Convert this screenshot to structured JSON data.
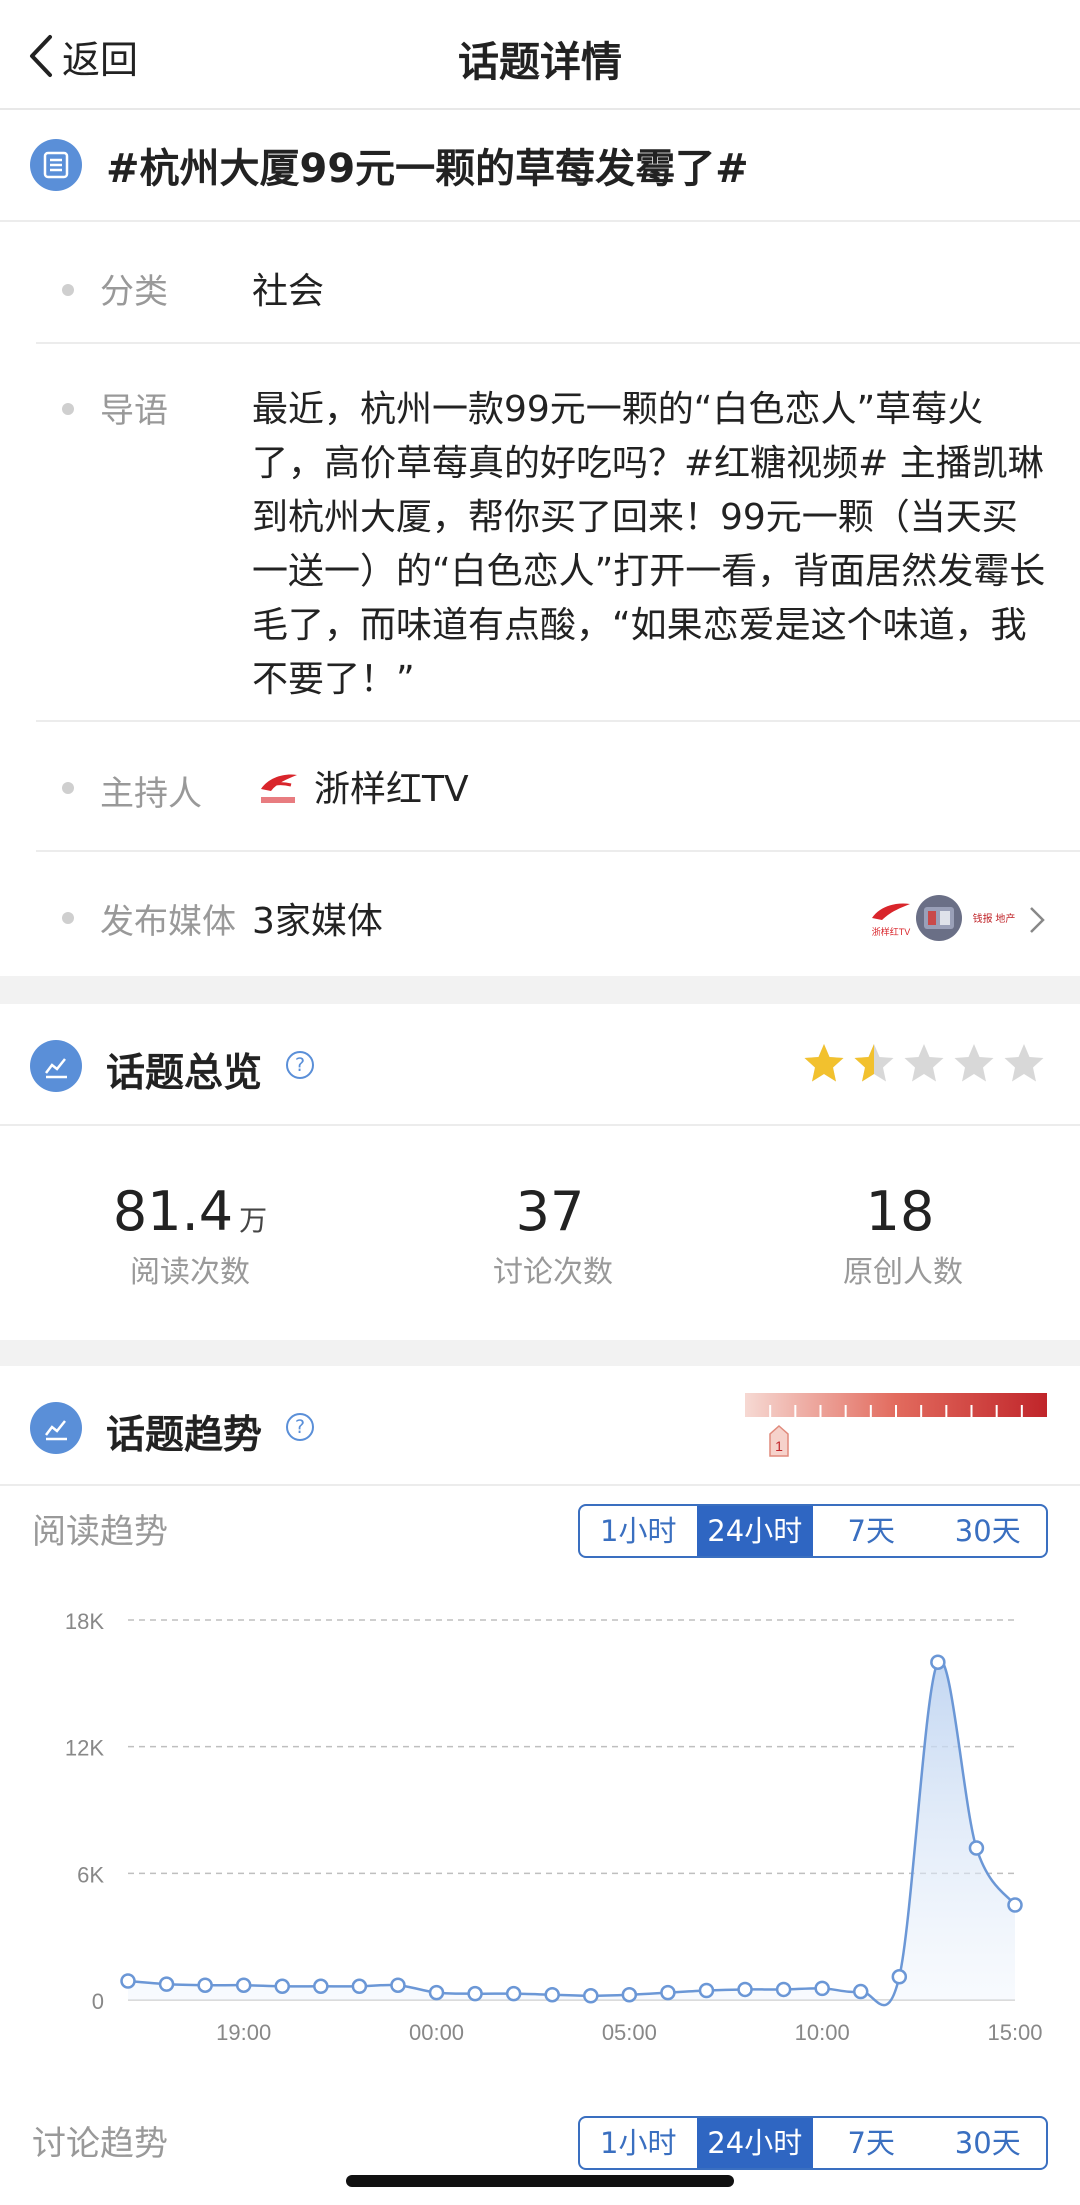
{
  "nav": {
    "back_label": "返回",
    "title": "话题详情"
  },
  "topic": {
    "title": "#杭州大厦99元一颗的草莓发霉了#"
  },
  "info": {
    "category_label": "分类",
    "category_value": "社会",
    "intro_label": "导语",
    "intro_text": "最近，杭州一款99元一颗的“白色恋人”草莓火了，高价草莓真的好吃吗？#红糖视频# 主播凯琳到杭州大厦，帮你买了回来！99元一颗（当天买一送一）的“白色恋人”打开一看，背面居然发霉长毛了，而味道有点酸，“如果恋爱是这个味道，我不要了！”",
    "host_label": "主持人",
    "host_name": "浙样红TV",
    "media_label": "发布媒体",
    "media_value": "3家媒体",
    "media_logo_1": "浙样红TV",
    "media_logo_3": "钱报 地产"
  },
  "overview": {
    "title": "话题总览",
    "help": "?",
    "rating_stars": 1.5,
    "rating_max": 5,
    "stats": [
      {
        "num": "81.4",
        "unit": "万",
        "label": "阅读次数"
      },
      {
        "num": "37",
        "unit": "",
        "label": "讨论次数"
      },
      {
        "num": "18",
        "unit": "",
        "label": "原创人数"
      }
    ]
  },
  "trend": {
    "title": "话题趋势",
    "help": "?",
    "heat_level": "1",
    "heat_level_fraction": 0.1,
    "read_label": "阅读趋势",
    "discuss_label": "讨论趋势",
    "tabs": [
      "1小时",
      "24小时",
      "7天",
      "30天"
    ],
    "active_tab": 1
  },
  "colors": {
    "accent": "#2f66c2",
    "icon_blue": "#5a8fd8",
    "star": "#f2c12e",
    "heat_dark": "#c0252a",
    "line": "#6b97d6"
  },
  "chart_data": {
    "type": "line",
    "y_ticks": [
      "18K",
      "12K",
      "6K",
      "0"
    ],
    "ylim": [
      0,
      18000
    ],
    "x_ticks": [
      "19:00",
      "00:00",
      "05:00",
      "10:00",
      "15:00"
    ],
    "x_tick_index": [
      3,
      8,
      13,
      18,
      23
    ],
    "values": [
      900,
      750,
      700,
      700,
      650,
      650,
      650,
      700,
      350,
      300,
      300,
      250,
      200,
      250,
      350,
      450,
      500,
      500,
      550,
      400,
      1100,
      16000,
      7200,
      4500
    ],
    "grid": true
  }
}
